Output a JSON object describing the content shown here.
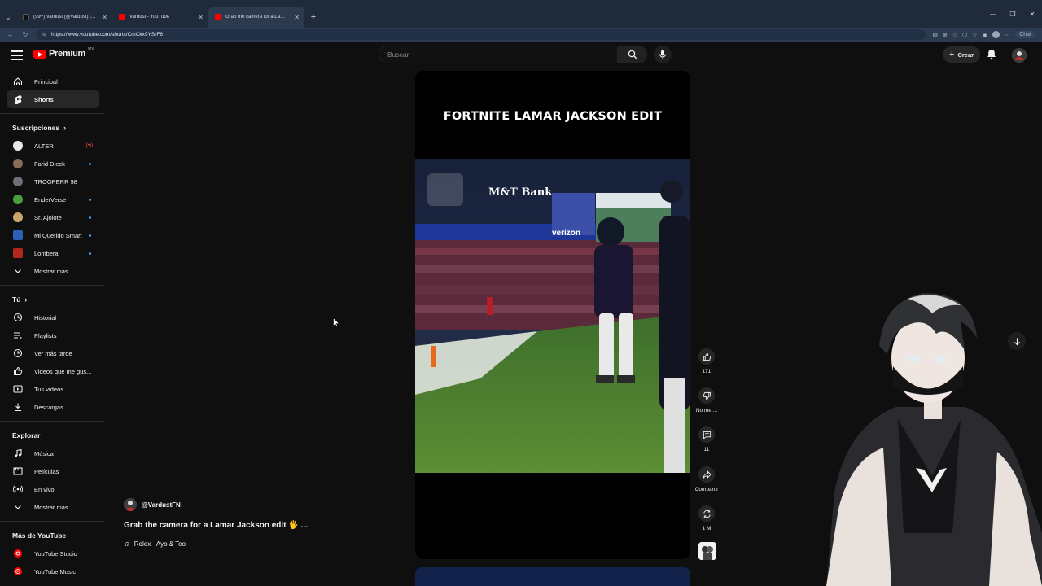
{
  "browser": {
    "tabs": [
      {
        "label": "(99+) Vardust (@vardust) | TikTok",
        "favicon_color": "#111111",
        "active": false
      },
      {
        "label": "Vardust - YouTube",
        "favicon_color": "#ff0000",
        "active": false
      },
      {
        "label": "Grab the camera for a Lamar",
        "favicon_color": "#ff0000",
        "active": true
      }
    ],
    "url": "https://www.youtube.com/shorts/CmCkx9YSrF8",
    "chat_label": "Chat"
  },
  "masthead": {
    "logo_text": "Premium",
    "region": "MX",
    "search_placeholder": "Buscar",
    "create_label": "Crear"
  },
  "sidebar": {
    "main": [
      {
        "label": "Principal",
        "icon": "home-icon"
      },
      {
        "label": "Shorts",
        "icon": "shorts-icon",
        "active": true
      }
    ],
    "subscriptions_heading": "Suscripciones",
    "subscriptions": [
      {
        "label": "ALTER",
        "avatar_color": "#e8e8e8",
        "badge": "live"
      },
      {
        "label": "Farid Dieck",
        "avatar_color": "#8a6b55",
        "badge": "dot"
      },
      {
        "label": "TROOPERR 98",
        "avatar_color": "#6d7077",
        "badge": ""
      },
      {
        "label": "EnderVerse",
        "avatar_color": "#47a03c",
        "badge": "dot"
      },
      {
        "label": "Sr. Ajolote",
        "avatar_color": "#c9a66b",
        "badge": "dot"
      },
      {
        "label": "Mi Querido Smart",
        "avatar_color": "#2b5fb8",
        "badge": "dot"
      },
      {
        "label": "Lombera",
        "avatar_color": "#b3261e",
        "badge": "dot"
      }
    ],
    "show_more": "Mostrar más",
    "you_heading": "Tú",
    "you": [
      {
        "label": "Historial",
        "icon": "history-icon"
      },
      {
        "label": "Playlists",
        "icon": "playlists-icon"
      },
      {
        "label": "Ver más tarde",
        "icon": "clock-icon"
      },
      {
        "label": "Videos que me gus...",
        "icon": "like-icon"
      },
      {
        "label": "Tus videos",
        "icon": "video-icon"
      },
      {
        "label": "Descargas",
        "icon": "download-icon"
      }
    ],
    "explore_heading": "Explorar",
    "explore": [
      {
        "label": "Música",
        "icon": "music-icon"
      },
      {
        "label": "Películas",
        "icon": "film-icon"
      },
      {
        "label": "En vivo",
        "icon": "live-icon"
      },
      {
        "label": "Mostrar más",
        "icon": "chevron-down-icon"
      }
    ],
    "more_heading": "Más de YouTube",
    "more": [
      {
        "label": "YouTube Studio",
        "icon": "studio-icon"
      },
      {
        "label": "YouTube Music",
        "icon": "yt-music-icon"
      }
    ]
  },
  "short": {
    "overlay_title": "FORTNITE LAMAR JACKSON EDIT",
    "channel": "@VardustFN",
    "title": "Grab the camera for a Lamar Jackson edit 🖐 ...",
    "music": "Rolex · Ayo & Teo",
    "scoreboard_sponsor": "M&T Bank",
    "scoreboard_ad": "verizon"
  },
  "actions": {
    "likes": "171",
    "dislike_label": "No me ...",
    "comments": "11",
    "share_label": "Compartir",
    "remix_count": "1 M"
  }
}
